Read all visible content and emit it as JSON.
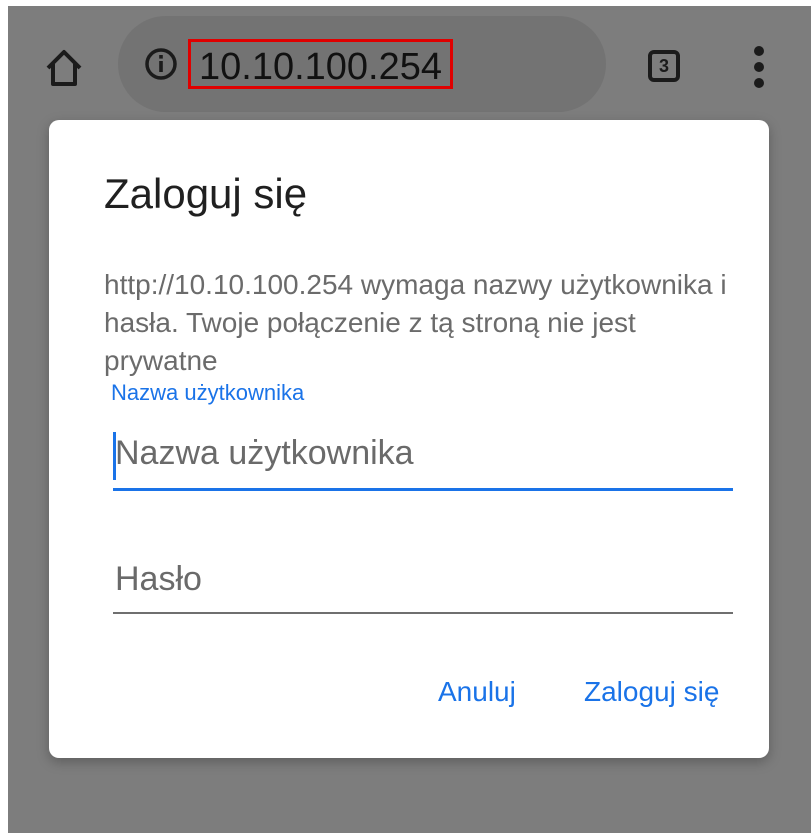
{
  "toolbar": {
    "url": "10.10.100.254",
    "tab_count": "3"
  },
  "dialog": {
    "title": "Zaloguj się",
    "message": "http://10.10.100.254 wymaga nazwy użytkownika i hasła. Twoje połączenie z tą stroną nie jest prywatne",
    "username_label": "Nazwa użytkownika",
    "username_placeholder": "Nazwa użytkownika",
    "password_placeholder": "Hasło",
    "cancel_label": "Anuluj",
    "login_label": "Zaloguj się"
  },
  "colors": {
    "accent": "#1a73e8",
    "url_highlight": "#e00000",
    "backdrop": "#7d7d7d"
  },
  "icons": [
    "home-icon",
    "info-icon",
    "tabs-icon",
    "more-vert-icon"
  ]
}
